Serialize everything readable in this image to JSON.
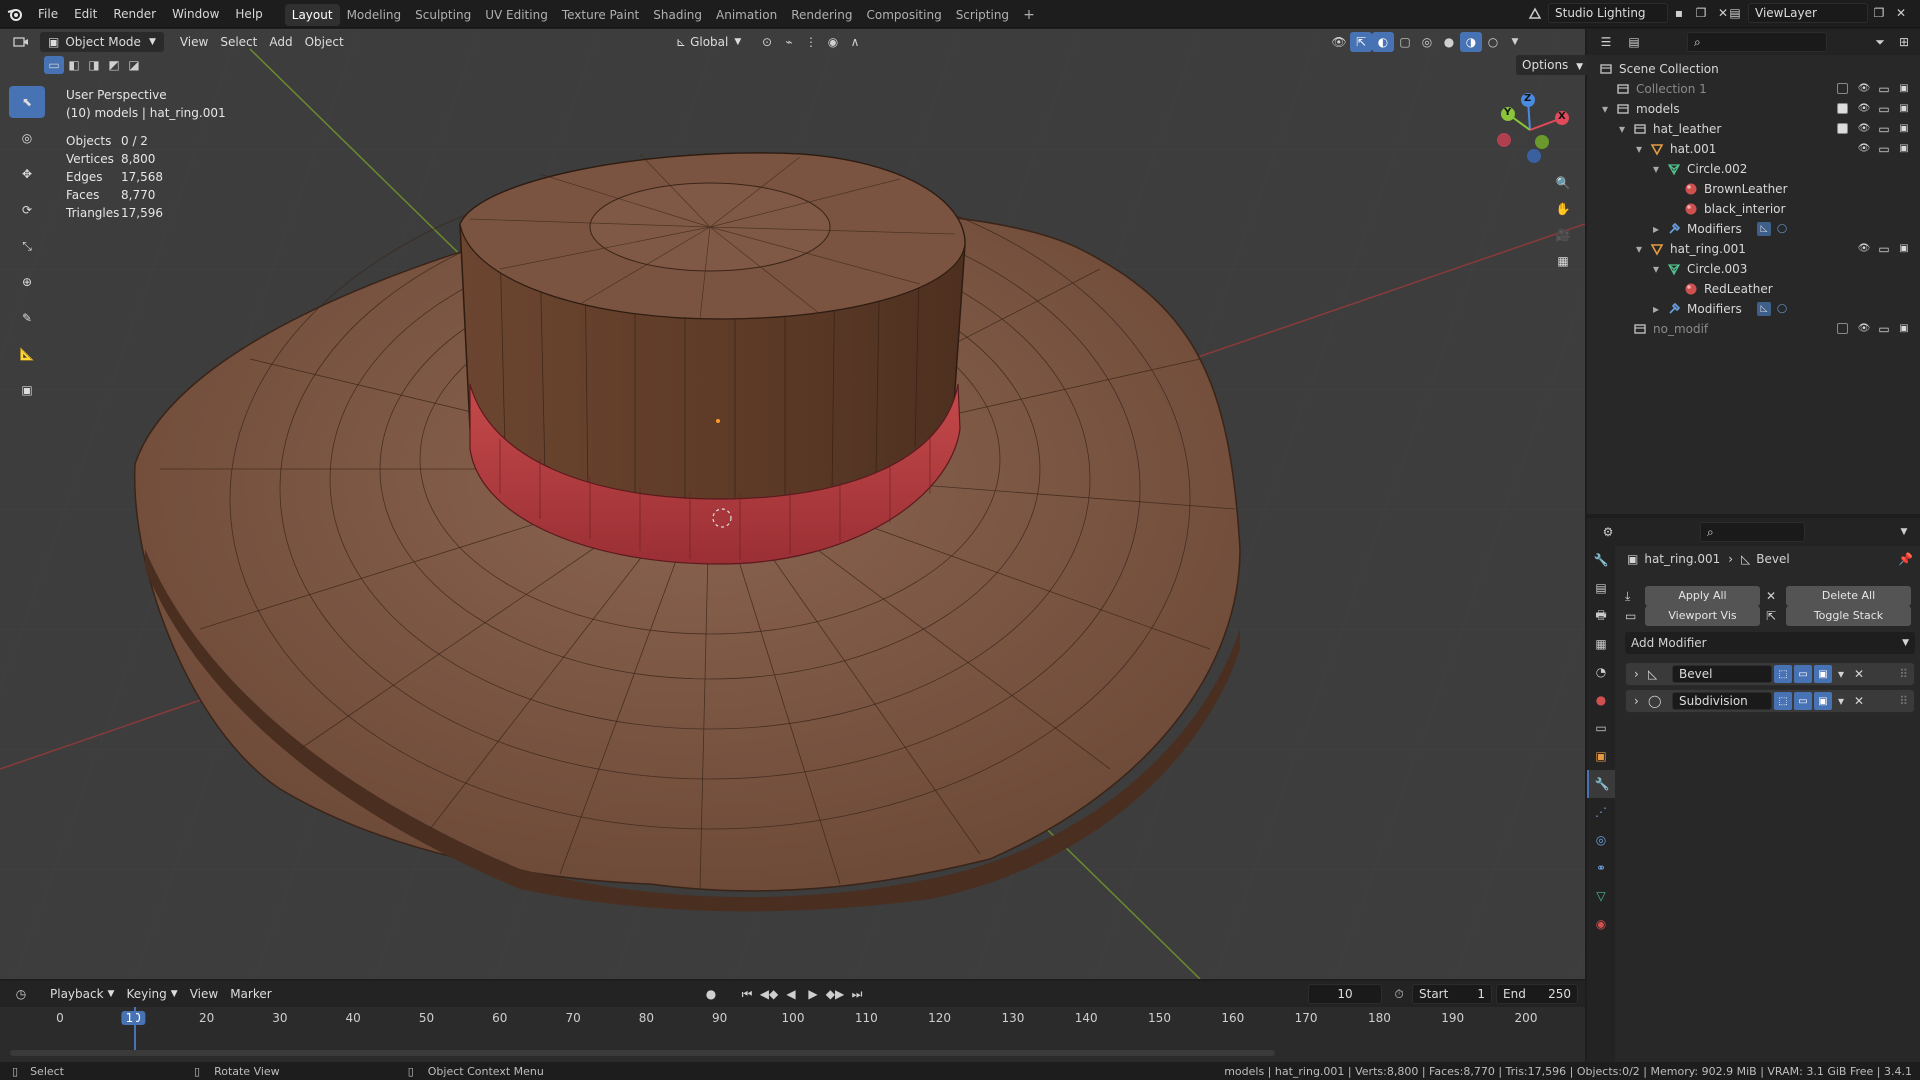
{
  "topbar": {
    "menus": [
      "File",
      "Edit",
      "Render",
      "Window",
      "Help"
    ],
    "workspaces": [
      "Layout",
      "Modeling",
      "Sculpting",
      "UV Editing",
      "Texture Paint",
      "Shading",
      "Animation",
      "Rendering",
      "Compositing",
      "Scripting"
    ],
    "active_workspace": "Layout",
    "add_tab": "+",
    "scene": "Studio Lighting",
    "view_layer": "ViewLayer"
  },
  "viewport": {
    "mode": "Object Mode",
    "menus": [
      "View",
      "Select",
      "Add",
      "Object"
    ],
    "transform": "Global",
    "options": "Options",
    "view_name": "User Perspective",
    "context": "(10) models | hat_ring.001",
    "stats": [
      {
        "k": "Objects",
        "v": "0 / 2"
      },
      {
        "k": "Vertices",
        "v": "8,800"
      },
      {
        "k": "Edges",
        "v": "17,568"
      },
      {
        "k": "Faces",
        "v": "8,770"
      },
      {
        "k": "Triangles",
        "v": "17,596"
      }
    ],
    "gizmo": {
      "z": "Z",
      "y": "Y",
      "x": "X"
    }
  },
  "timeline": {
    "menus": [
      "Playback",
      "Keying",
      "View",
      "Marker"
    ],
    "current_frame": "10",
    "start_label": "Start",
    "start": "1",
    "end_label": "End",
    "end": "250",
    "ticks": [
      "0",
      "10",
      "20",
      "30",
      "40",
      "50",
      "60",
      "70",
      "80",
      "90",
      "100",
      "110",
      "120",
      "130",
      "140",
      "150",
      "160",
      "170",
      "180",
      "190",
      "200"
    ]
  },
  "status": {
    "select": "Select",
    "rotate": "Rotate View",
    "context_menu": "Object Context Menu",
    "info": "models | hat_ring.001 | Verts:8,800 | Faces:8,770 | Tris:17,596 | Objects:0/2 | Memory: 902.9 MiB | VRAM: 3.1 GiB Free | 3.4.1"
  },
  "outliner": {
    "rows": [
      {
        "label": "Scene Collection",
        "indent": 0,
        "icon": "scene-collection",
        "color": "#bdbdbd",
        "dim": false,
        "vis": false
      },
      {
        "label": "Collection 1",
        "indent": 1,
        "icon": "collection",
        "color": "#bdbdbd",
        "dim": true,
        "vis": true
      },
      {
        "label": "models",
        "indent": 1,
        "icon": "collection",
        "color": "#bdbdbd",
        "dim": false,
        "vis": true,
        "expanded": true
      },
      {
        "label": "hat_leather",
        "indent": 2,
        "icon": "collection",
        "color": "#bdbdbd",
        "dim": false,
        "vis": true,
        "expanded": true
      },
      {
        "label": "hat.001",
        "indent": 3,
        "icon": "mesh-object",
        "color": "#e59b42",
        "dim": false,
        "vis": true,
        "expanded": true
      },
      {
        "label": "Circle.002",
        "indent": 4,
        "icon": "mesh-data",
        "color": "#4fbf8b",
        "dim": false,
        "vis": false,
        "expanded": true
      },
      {
        "label": "BrownLeather",
        "indent": 5,
        "icon": "material",
        "color": "#d05050",
        "dim": false,
        "vis": false
      },
      {
        "label": "black_interior",
        "indent": 5,
        "icon": "material",
        "color": "#d05050",
        "dim": false,
        "vis": false
      },
      {
        "label": "Modifiers",
        "indent": 4,
        "icon": "modifier",
        "color": "#6aa0e0",
        "dim": false,
        "vis": false,
        "collapsed": true
      },
      {
        "label": "hat_ring.001",
        "indent": 3,
        "icon": "mesh-object",
        "color": "#e59b42",
        "dim": false,
        "vis": true,
        "expanded": true
      },
      {
        "label": "Circle.003",
        "indent": 4,
        "icon": "mesh-data",
        "color": "#4fbf8b",
        "dim": false,
        "vis": false,
        "expanded": true
      },
      {
        "label": "RedLeather",
        "indent": 5,
        "icon": "material",
        "color": "#d05050",
        "dim": false,
        "vis": false
      },
      {
        "label": "Modifiers",
        "indent": 4,
        "icon": "modifier",
        "color": "#6aa0e0",
        "dim": false,
        "vis": false,
        "collapsed": true
      },
      {
        "label": "no_modif",
        "indent": 2,
        "icon": "collection",
        "color": "#bdbdbd",
        "dim": true,
        "vis": true
      }
    ]
  },
  "properties": {
    "object": "hat_ring.001",
    "modifier": "Bevel",
    "apply_all": "Apply All",
    "delete_all": "Delete All",
    "viewport_vis": "Viewport Vis",
    "toggle_stack": "Toggle Stack",
    "add_modifier": "Add Modifier",
    "modifiers": [
      "Bevel",
      "Subdivision"
    ]
  }
}
